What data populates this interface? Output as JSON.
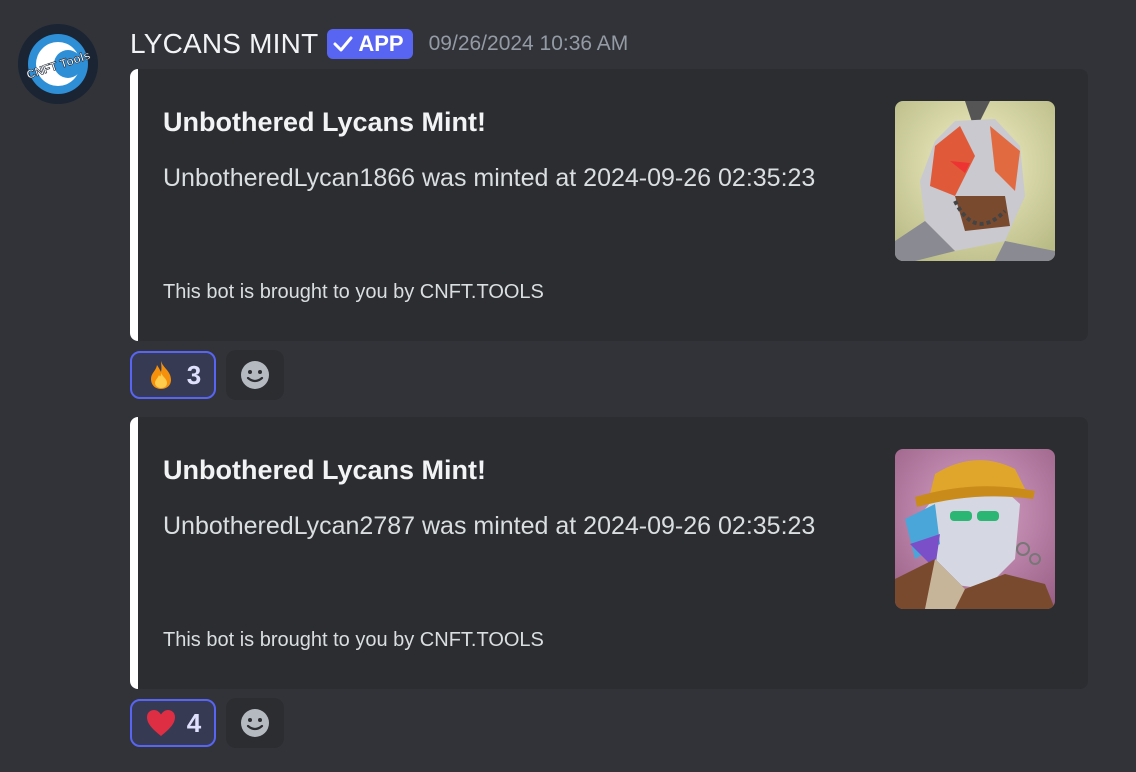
{
  "header": {
    "username": "LYCANS MINT",
    "badge_label": "APP",
    "timestamp": "09/26/2024 10:36 AM",
    "avatar_text": "CNFT Tools"
  },
  "embeds": [
    {
      "title": "Unbothered Lycans Mint!",
      "description": "UnbotheredLycan1866 was minted at 2024-09-26 02:35:23",
      "footer": "This bot is brought to you by CNFT.TOOLS",
      "border_color": "#ffffff"
    },
    {
      "title": "Unbothered Lycans Mint!",
      "description": "UnbotheredLycan2787 was minted at 2024-09-26 02:35:23",
      "footer": "This bot is brought to you by CNFT.TOOLS",
      "border_color": "#ffffff"
    }
  ],
  "reactions": [
    {
      "emoji": "fire-emoji",
      "count": "3"
    },
    {
      "emoji": "heart-emoji",
      "count": "4"
    }
  ],
  "colors": {
    "background": "#313338",
    "embed_background": "#2b2d31",
    "accent": "#5865f2",
    "muted_text": "#949ba4"
  }
}
